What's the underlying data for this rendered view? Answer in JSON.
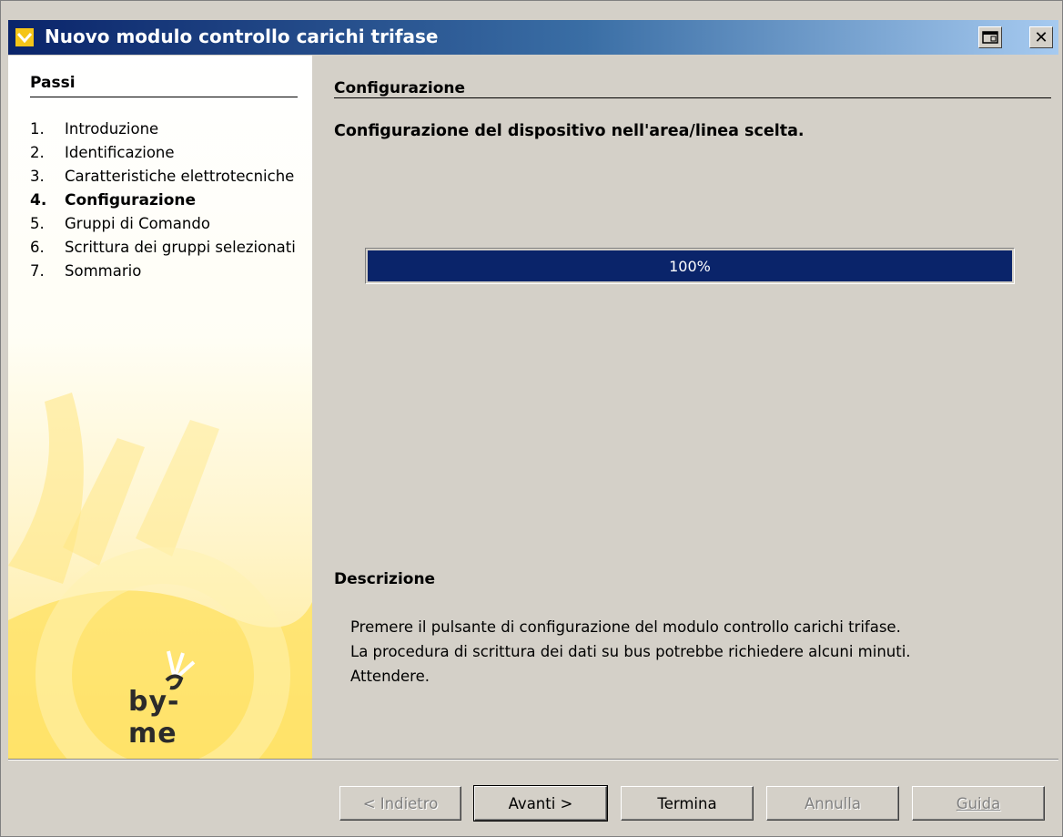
{
  "window": {
    "title": "Nuovo modulo controllo carichi trifase",
    "accent_color": "#0a246a"
  },
  "sidebar": {
    "heading": "Passi",
    "steps": [
      {
        "num": "1.",
        "label": "Introduzione"
      },
      {
        "num": "2.",
        "label": "Identificazione"
      },
      {
        "num": "3.",
        "label": "Caratteristiche elettrotecniche"
      },
      {
        "num": "4.",
        "label": "Configurazione",
        "active": true
      },
      {
        "num": "5.",
        "label": "Gruppi di Comando"
      },
      {
        "num": "6.",
        "label": "Scrittura dei gruppi selezionati"
      },
      {
        "num": "7.",
        "label": "Sommario"
      }
    ],
    "logo_text": "by-me"
  },
  "main": {
    "section_title": "Configurazione",
    "subtitle": "Configurazione del dispositivo nell'area/linea scelta.",
    "progress": {
      "value_percent": 100,
      "label": "100%"
    },
    "description_title": "Descrizione",
    "description_lines": [
      "Premere il pulsante di configurazione del modulo controllo carichi trifase.",
      "La procedura di scrittura dei dati su bus potrebbe richiedere alcuni minuti.",
      "Attendere."
    ]
  },
  "buttons": {
    "back": "< Indietro",
    "next": "Avanti >",
    "finish": "Termina",
    "cancel": "Annulla",
    "help": "Guida"
  }
}
